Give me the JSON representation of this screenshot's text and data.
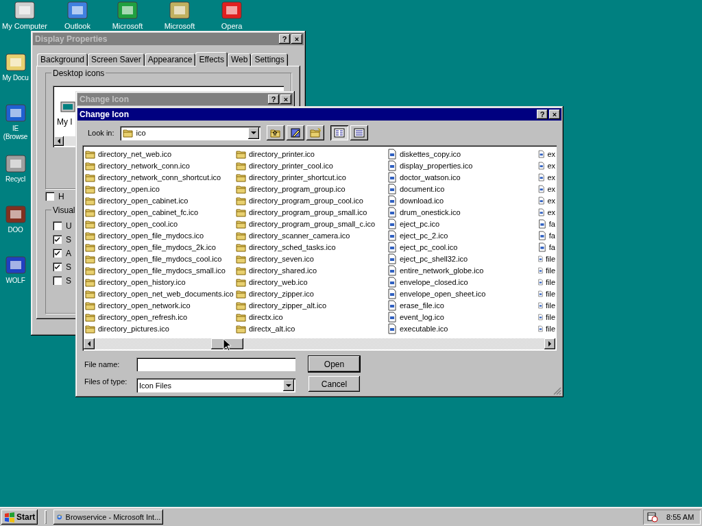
{
  "desktop": {
    "icons": [
      {
        "label": "My Computer"
      },
      {
        "label": "Outlook"
      },
      {
        "label": "Microsoft"
      },
      {
        "label": "Microsoft"
      },
      {
        "label": "Opera"
      },
      {
        "label": "My Docu"
      },
      {
        "label": "IE",
        "label_2": "(Browse"
      },
      {
        "label": "Recycl"
      },
      {
        "label": "DOO"
      },
      {
        "label": "WOLF"
      }
    ]
  },
  "display_properties": {
    "title": "Display Properties",
    "active": false,
    "help": "?",
    "close": "×",
    "tabs": [
      {
        "label": "Background",
        "selected": false
      },
      {
        "label": "Screen Saver",
        "selected": false
      },
      {
        "label": "Appearance",
        "selected": false
      },
      {
        "label": "Effects",
        "selected": true
      },
      {
        "label": "Web",
        "selected": false
      },
      {
        "label": "Settings",
        "selected": false
      }
    ],
    "desktop_icons": {
      "title": "Desktop icons",
      "item": "My I"
    },
    "hide_option": {
      "label": "H",
      "checked": false
    },
    "visual": {
      "title": "Visual",
      "options": [
        {
          "label": "U",
          "checked": false
        },
        {
          "label": "S",
          "checked": true
        },
        {
          "label": "A",
          "checked": true
        },
        {
          "label": "S",
          "checked": true
        },
        {
          "label": "S",
          "checked": false
        }
      ]
    }
  },
  "change_icon_behind": {
    "title": "Change Icon",
    "active": false,
    "help": "?",
    "close": "×"
  },
  "change_icon": {
    "title": "Change Icon",
    "active": true,
    "help": "?",
    "close": "×",
    "look_in": {
      "label": "Look in:",
      "value": "ico"
    },
    "files": [
      {
        "name": "directory_net_web.ico",
        "selected": false
      },
      {
        "name": "directory_network_conn.ico",
        "selected": false
      },
      {
        "name": "directory_network_conn_shortcut.ico",
        "selected": false
      },
      {
        "name": "directory_open.ico",
        "selected": false
      },
      {
        "name": "directory_open_cabinet.ico",
        "selected": false
      },
      {
        "name": "directory_open_cabinet_fc.ico",
        "selected": false
      },
      {
        "name": "directory_open_cool.ico",
        "selected": false
      },
      {
        "name": "directory_open_file_mydocs.ico",
        "selected": false
      },
      {
        "name": "directory_open_file_mydocs_2k.ico",
        "selected": false
      },
      {
        "name": "directory_open_file_mydocs_cool.ico",
        "selected": false
      },
      {
        "name": "directory_open_file_mydocs_small.ico",
        "selected": false
      },
      {
        "name": "directory_open_history.ico",
        "selected": false
      },
      {
        "name": "directory_open_net_web_documents.ico",
        "selected": false
      },
      {
        "name": "directory_open_network.ico",
        "selected": false
      },
      {
        "name": "directory_open_refresh.ico",
        "selected": false
      },
      {
        "name": "directory_pictures.ico",
        "selected": false
      },
      {
        "name": "directory_printer.ico",
        "selected": false
      },
      {
        "name": "directory_printer_cool.ico",
        "selected": false
      },
      {
        "name": "directory_printer_shortcut.ico",
        "selected": false
      },
      {
        "name": "directory_program_group.ico",
        "selected": false
      },
      {
        "name": "directory_program_group_cool.ico",
        "selected": false
      },
      {
        "name": "directory_program_group_small.ico",
        "selected": false
      },
      {
        "name": "directory_program_group_small_c.ico",
        "selected": false
      },
      {
        "name": "directory_scanner_camera.ico",
        "selected": false
      },
      {
        "name": "directory_sched_tasks.ico",
        "selected": false
      },
      {
        "name": "directory_seven.ico",
        "selected": false
      },
      {
        "name": "directory_shared.ico",
        "selected": false
      },
      {
        "name": "directory_web.ico",
        "selected": false
      },
      {
        "name": "directory_zipper.ico",
        "selected": false
      },
      {
        "name": "directory_zipper_alt.ico",
        "selected": false
      },
      {
        "name": "directx.ico",
        "selected": false
      },
      {
        "name": "directx_alt.ico",
        "selected": false
      },
      {
        "name": "diskettes_copy.ico",
        "selected": false
      },
      {
        "name": "display_properties.ico",
        "selected": false
      },
      {
        "name": "doctor_watson.ico",
        "selected": false
      },
      {
        "name": "document.ico",
        "selected": false
      },
      {
        "name": "download.ico",
        "selected": false
      },
      {
        "name": "drum_onestick.ico",
        "selected": false
      },
      {
        "name": "eject_pc.ico",
        "selected": false
      },
      {
        "name": "eject_pc_2.ico",
        "selected": false
      },
      {
        "name": "eject_pc_cool.ico",
        "selected": false
      },
      {
        "name": "eject_pc_shell32.ico",
        "selected": false
      },
      {
        "name": "entire_network_globe.ico",
        "selected": false
      },
      {
        "name": "envelope_closed.ico",
        "selected": false
      },
      {
        "name": "envelope_open_sheet.ico",
        "selected": false
      },
      {
        "name": "erase_file.ico",
        "selected": false
      },
      {
        "name": "event_log.ico",
        "selected": false
      },
      {
        "name": "executable.ico",
        "selected": false
      },
      {
        "name": "ex",
        "selected": false
      },
      {
        "name": "ex",
        "selected": false
      },
      {
        "name": "ex",
        "selected": false
      },
      {
        "name": "ex",
        "selected": false
      },
      {
        "name": "ex",
        "selected": false
      },
      {
        "name": "ex",
        "selected": false
      },
      {
        "name": "fa",
        "selected": false
      },
      {
        "name": "fa",
        "selected": false
      },
      {
        "name": "fa",
        "selected": false
      },
      {
        "name": "file",
        "selected": false
      },
      {
        "name": "file",
        "selected": false
      },
      {
        "name": "file",
        "selected": false
      },
      {
        "name": "file",
        "selected": false
      },
      {
        "name": "file",
        "selected": false
      },
      {
        "name": "file",
        "selected": false
      },
      {
        "name": "file",
        "selected": false
      }
    ],
    "file_name": {
      "label": "File name:"
    },
    "files_of_type": {
      "label": "Files of type:",
      "value": "Icon Files"
    },
    "buttons": [
      {
        "label": "Open",
        "default": true
      },
      {
        "label": "Cancel",
        "default": false
      }
    ]
  },
  "taskbar": {
    "start": "Start",
    "tasks": [
      {
        "label": "Browservice - Microsoft Int...",
        "selected": false
      }
    ],
    "clock": "8:55 AM"
  }
}
